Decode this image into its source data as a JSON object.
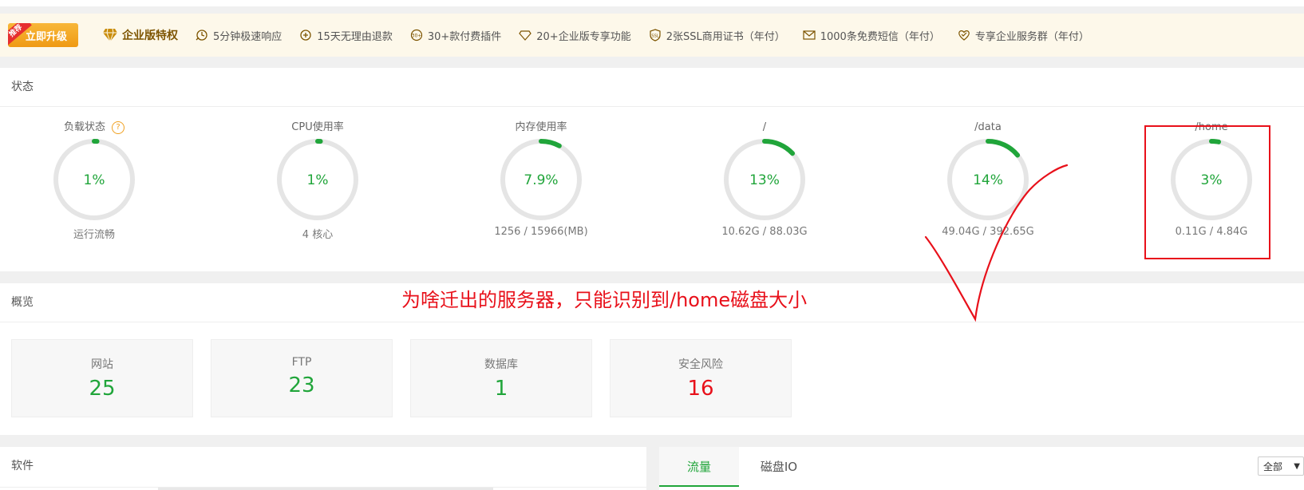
{
  "promo": {
    "recommend_tag": "推荐",
    "upgrade_label": "立即升级",
    "enterprise_title": "企业版特权",
    "features": [
      {
        "icon": "speed-response-icon",
        "label": "5分钟极速响应"
      },
      {
        "icon": "refund-icon",
        "label": "15天无理由退款"
      },
      {
        "icon": "plugin-icon",
        "label": "30+款付费插件"
      },
      {
        "icon": "diamond-outline-icon",
        "label": "20+企业版专享功能"
      },
      {
        "icon": "ssl-shield-icon",
        "label": "2张SSL商用证书（年付）"
      },
      {
        "icon": "mail-icon",
        "label": "1000条免费短信（年付）"
      },
      {
        "icon": "heart-group-icon",
        "label": "专享企业服务群（年付）"
      }
    ],
    "accent_color": "#f2a21d"
  },
  "status": {
    "title": "状态",
    "help_glyph": "?",
    "gauges": [
      {
        "title": "负载状态",
        "value_text": "1%",
        "percent": 1,
        "sub": "运行流畅",
        "has_help": true
      },
      {
        "title": "CPU使用率",
        "value_text": "1%",
        "percent": 1,
        "sub": "4 核心"
      },
      {
        "title": "内存使用率",
        "value_text": "7.9%",
        "percent": 7.9,
        "sub": "1256 / 15966(MB)"
      },
      {
        "title": "/",
        "value_text": "13%",
        "percent": 13,
        "sub": "10.62G / 88.03G"
      },
      {
        "title": "/data",
        "value_text": "14%",
        "percent": 14,
        "sub": "49.04G / 392.65G"
      },
      {
        "title": "/home",
        "value_text": "3%",
        "percent": 3,
        "sub": "0.11G / 4.84G"
      }
    ],
    "gauge_color": "#20a53a",
    "track_color": "#e5e5e5"
  },
  "annotation": {
    "text": "为啥迁出的服务器，只能识别到/home磁盘大小",
    "color": "#e8101a"
  },
  "overview": {
    "title": "概览",
    "cards": [
      {
        "label": "网站",
        "value": "25"
      },
      {
        "label": "FTP",
        "value": "23"
      },
      {
        "label": "数据库",
        "value": "1"
      },
      {
        "label": "安全风险",
        "value": "16",
        "danger": true
      }
    ]
  },
  "software": {
    "title": "软件"
  },
  "traffic": {
    "tabs": [
      "流量",
      "磁盘IO"
    ],
    "active_tab": 0,
    "range_select": "全部"
  }
}
